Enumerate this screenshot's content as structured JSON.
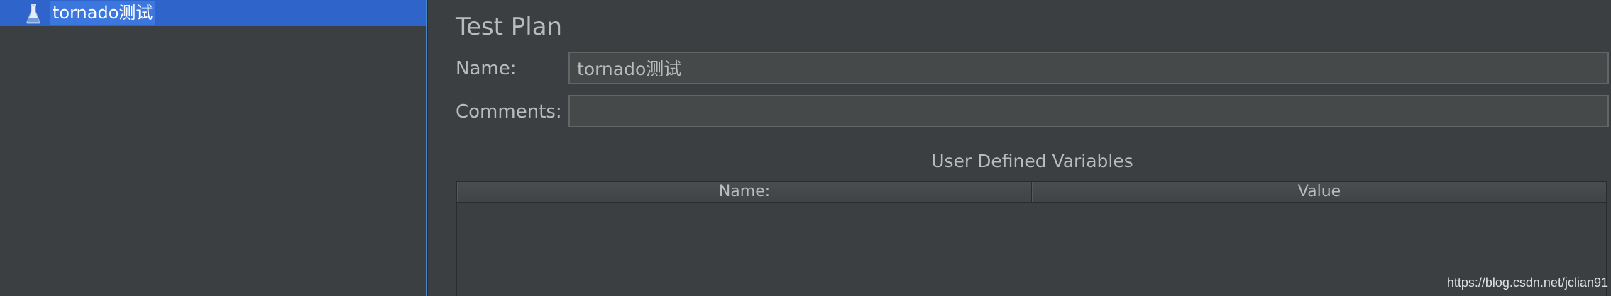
{
  "tree": {
    "items": [
      {
        "label": "tornado测试",
        "icon": "test-plan-icon",
        "selected": true
      }
    ]
  },
  "test_plan": {
    "title": "Test Plan",
    "name_label": "Name:",
    "name_value": "tornado测试",
    "comments_label": "Comments:",
    "comments_value": ""
  },
  "user_defined_variables": {
    "title": "User Defined Variables",
    "columns": [
      "Name:",
      "Value"
    ],
    "rows": []
  },
  "watermark": "https://blog.csdn.net/jclian91",
  "colors": {
    "selection": "#2f65ca",
    "background": "#3c3f41",
    "input_background": "#45494a"
  }
}
